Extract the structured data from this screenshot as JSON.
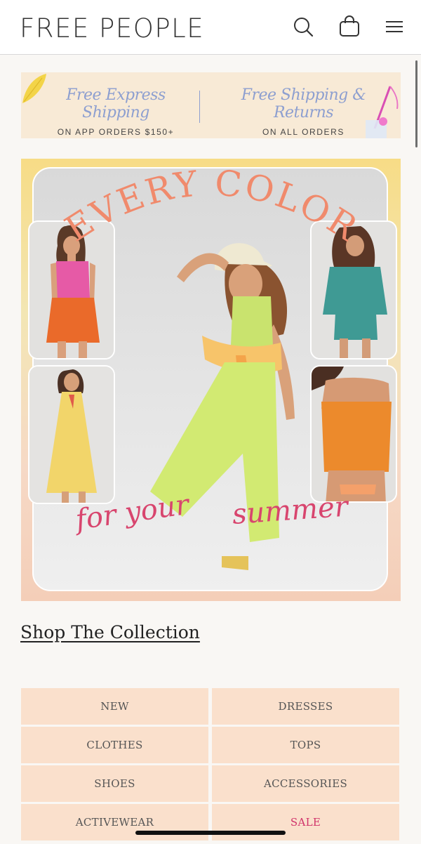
{
  "header": {
    "logo": "FREE PEOPLE",
    "icons": [
      "search-icon",
      "bag-icon",
      "menu-icon"
    ]
  },
  "promo": {
    "left_title": "Free Express Shipping",
    "left_sub": "ON APP ORDERS $150+",
    "right_title": "Free Shipping & Returns",
    "right_sub": "ON ALL ORDERS"
  },
  "hero": {
    "headline": "EVERY COLOR",
    "tagline_1": "for your",
    "tagline_2": "summer"
  },
  "shop_link": "Shop The Collection",
  "categories": [
    {
      "label": "NEW"
    },
    {
      "label": "DRESSES"
    },
    {
      "label": "CLOTHES"
    },
    {
      "label": "TOPS"
    },
    {
      "label": "SHOES"
    },
    {
      "label": "ACCESSORIES"
    },
    {
      "label": "ACTIVEWEAR"
    },
    {
      "label": "SALE"
    }
  ],
  "colors": {
    "accent_blue": "#8d9fd0",
    "headline_coral": "#f08a6c",
    "script_pink": "#d8456e",
    "category_bg": "#fae0cc",
    "sale": "#d0326a"
  }
}
